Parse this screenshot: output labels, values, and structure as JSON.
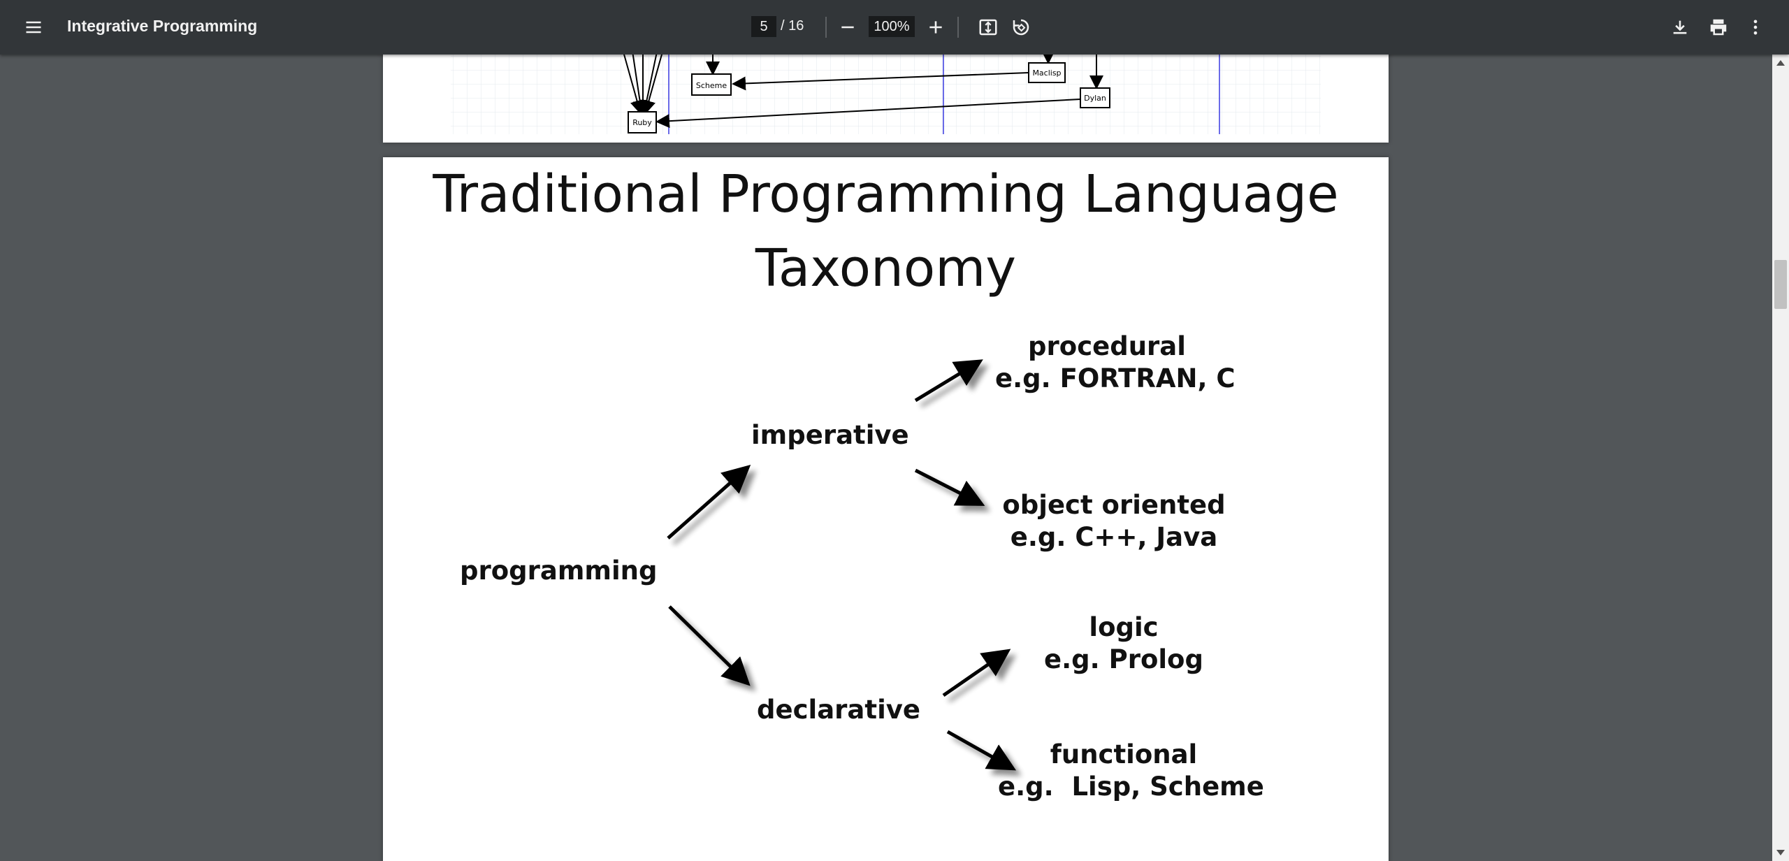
{
  "toolbar": {
    "title": "Integrative Programming",
    "current_page": "5",
    "page_total": "/ 16",
    "zoom": "100%"
  },
  "prev_page": {
    "nodes": [
      "Scheme",
      "Maclisp",
      "Dylan",
      "Ruby"
    ]
  },
  "slide": {
    "title_line1": "Traditional Programming Language",
    "title_line2": "Taxonomy",
    "taxonomy": {
      "root": "programming",
      "imperative": "imperative",
      "declarative": "declarative",
      "procedural": {
        "name": "procedural",
        "example": "e.g. FORTRAN, C"
      },
      "object_oriented": {
        "name": "object oriented",
        "example": "e.g. C++, Java"
      },
      "logic": {
        "name": "logic",
        "example": "e.g. Prolog"
      },
      "functional": {
        "name": "functional",
        "example": "e.g.  Lisp, Scheme"
      }
    }
  },
  "icons": {
    "menu": "menu-icon",
    "zoom_out": "minus-icon",
    "zoom_in": "plus-icon",
    "fit": "fit-to-page-icon",
    "rotate": "rotate-icon",
    "download": "download-icon",
    "print": "print-icon",
    "more": "more-vert-icon"
  },
  "colors": {
    "toolbar_bg": "#323639",
    "viewer_bg": "#525659",
    "page_bg": "#ffffff"
  }
}
